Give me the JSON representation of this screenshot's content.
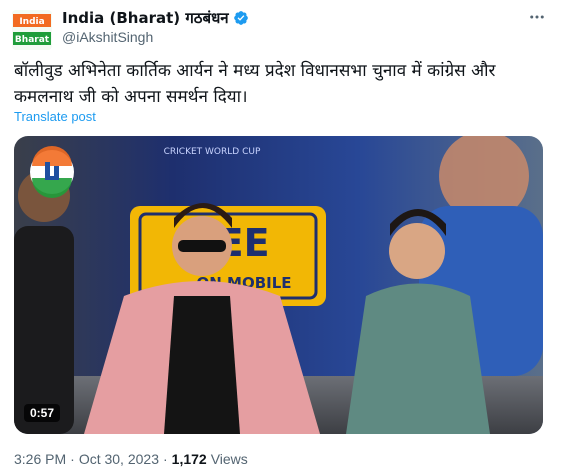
{
  "author": {
    "display_name": "India (Bharat) गठबंधन",
    "handle": "@iAkshitSingh",
    "avatar_text": [
      "India",
      "Bharat"
    ],
    "verified": true
  },
  "tweet": {
    "text": "बॉलीवुड अभिनेता कार्तिक आर्यन ने मध्य प्रदेश विधानसभा चुनाव में कांग्रेस और कमलनाथ जी को अपना समर्थन दिया।",
    "translate_label": "Translate post"
  },
  "media": {
    "duration": "0:57",
    "banner_text_top": "CRICKET WORLD CUP",
    "banner_text_big": "REE",
    "banner_text_sub": "ON MOBILE"
  },
  "meta": {
    "time": "3:26 PM",
    "sep": "·",
    "date": "Oct 30, 2023",
    "views_count": "1,172",
    "views_label": "Views"
  },
  "colors": {
    "accent": "#1d9bf0",
    "avatar_bg": "#e8f5e9"
  }
}
